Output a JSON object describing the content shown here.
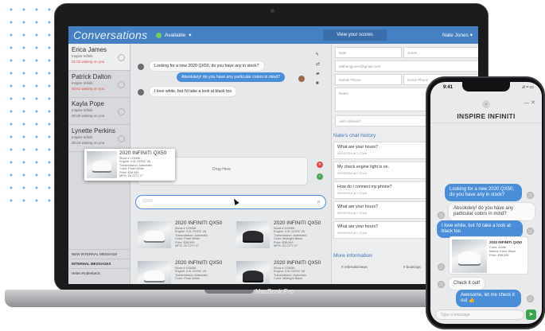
{
  "app": {
    "logo": "Conversations",
    "status": "Available",
    "scores_button": "View your scores",
    "user": "Nate Jones"
  },
  "colors": {
    "accent": "#4580c2",
    "bubble_out": "#4a8ed7",
    "waiting": "#e0473b",
    "online": "#6fcf5a",
    "send": "#39a54c"
  },
  "sidebar": {
    "conversations": [
      {
        "name": "Erica James",
        "company": "Inspire Infiniti",
        "wait": "01:22 waiting on you",
        "red": true
      },
      {
        "name": "Patrick Dalton",
        "company": "Inspire Infiniti",
        "wait": "00:51 waiting on you",
        "red": true
      },
      {
        "name": "Kayla Pope",
        "company": "Inspire Infiniti",
        "wait": "00:40 waiting on you",
        "red": false
      },
      {
        "name": "Lynette Perkins",
        "company": "Inspire Infiniti",
        "wait": "00:34 waiting on you",
        "red": false
      }
    ],
    "new_message": "NEW INTERNAL MESSAGE",
    "internal": "INTERNAL MESSAGES",
    "person": "Helen Rodenbeck"
  },
  "chat": {
    "m1": "Looking for a new 2020 QX50, do you have any in stock?",
    "m2": "Absolutely! do you have any particular colors in mind?",
    "m3": "I love white, but I'd take a look at black too",
    "drag": "Drag Here",
    "search_placeholder": "QX50"
  },
  "card": {
    "title": "2020 INFINITI QX50",
    "specs": "Stock # 123456\nEngine: 3.0L DOHC V6\nTransmission: Automatic\nColor: Pearl White\nPrice: $38,999\nMPG: 20 CITY 27"
  },
  "tiles": [
    {
      "title": "2020 INFINITI QX50",
      "specs": "Stock # 123456\nEngine: 3.0L DOHC V6\nTransmission: Automatic\nColor: Pearl White\nPrice: $38,999\nMPG: 20 CITY 27"
    },
    {
      "title": "2020 INFINITI QX50",
      "specs": "Stock # 123456\nEngine: 3.0L DOHC V6\nTransmission: Automatic\nColor: Midnight Black\nPrice: $38,999\nMPG: 20 CITY 27"
    },
    {
      "title": "2020 INFINITI QX50",
      "specs": "Stock # 123456\nEngine: 3.0L DOHC V6\nTransmission: Automatic\nColor: Pearl White"
    },
    {
      "title": "2020 INFINITI QX50",
      "specs": "Stock # 123456\nEngine: 3.0L DOHC V6\nTransmission: Automatic\nColor: Midnight Black"
    }
  ],
  "right": {
    "first": "Nate",
    "last": "Jones",
    "email": "nathangjones@gmail.com",
    "mobile": "Mobile Phone",
    "home": "Home Phone",
    "notes": "Notes",
    "address": "Add Address?",
    "history_title": "Nate's chat history",
    "history": [
      {
        "q": "What are your hours?",
        "d": "09/03/2016 at 2:37pm"
      },
      {
        "q": "My check engine light is on.",
        "d": "09/03/2016 at 2:37pm"
      },
      {
        "q": "How do I connect my phone?",
        "d": "09/03/2016 at 2:37pm"
      },
      {
        "q": "What are your hours?",
        "d": "09/03/2016 at 2:37pm"
      },
      {
        "q": "What are your hours?",
        "d": "09/03/2016 at 2:37pm"
      }
    ],
    "more": "More information",
    "label1": "# referrals/views",
    "label2": "# bookings"
  },
  "laptop": {
    "label": "MacBook Pro"
  },
  "phone": {
    "time": "9:41",
    "signal": ".ıl ≈ ▭",
    "title": "INSPIRE INFINITI",
    "m1": "Looking for a new 2020 QX50, do you have any in stock?",
    "m2": "Absolutely! do you have any particular colors in mind?",
    "m3": "I love white, but I'd take a look at black too",
    "card_title": "2020 INFINITI QX50",
    "card_specs": "Color: White\nInterior Color: Black\nPrice: $38,999",
    "m4": "Check it out!",
    "m5": "Awesome, let me check it out 👍",
    "input": "Type a message"
  }
}
